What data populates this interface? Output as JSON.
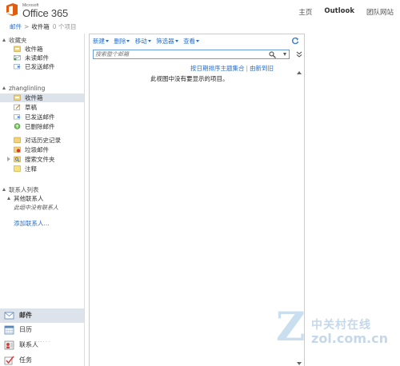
{
  "header": {
    "logo_small": "Microsoft",
    "logo_text": "Office 365",
    "nav": [
      {
        "label": "主页",
        "active": false
      },
      {
        "label": "Outlook",
        "active": true
      },
      {
        "label": "团队网站",
        "active": false
      }
    ]
  },
  "breadcrumb": {
    "root": "邮件",
    "separator": ">",
    "current": "收件箱",
    "count": "0 个项目"
  },
  "favorites": {
    "title": "收藏夹",
    "items": [
      {
        "label": "收件箱",
        "icon": "inbox-icon"
      },
      {
        "label": "未读邮件",
        "icon": "unread-mail-icon"
      },
      {
        "label": "已发送邮件",
        "icon": "sent-mail-icon"
      }
    ]
  },
  "mailbox": {
    "title": "zhanglinling",
    "items": [
      {
        "label": "收件箱",
        "icon": "inbox-icon",
        "selected": true
      },
      {
        "label": "草稿",
        "icon": "drafts-icon"
      },
      {
        "label": "已发送邮件",
        "icon": "sent-mail-icon"
      },
      {
        "label": "已删除邮件",
        "icon": "deleted-mail-icon"
      },
      {
        "label": "对话历史记录",
        "icon": "conversation-history-icon"
      },
      {
        "label": "垃圾邮件",
        "icon": "junk-mail-icon"
      },
      {
        "label": "搜索文件夹",
        "icon": "search-folder-icon"
      },
      {
        "label": "注释",
        "icon": "notes-icon"
      }
    ]
  },
  "contacts": {
    "title": "联系人列表",
    "group": "其他联系人",
    "empty": "此组中没有联系人",
    "add": "添加联系人..."
  },
  "bottom_nav": [
    {
      "label": "邮件",
      "icon": "mail-icon",
      "selected": true
    },
    {
      "label": "日历",
      "icon": "calendar-icon"
    },
    {
      "label": "联系人",
      "icon": "contacts-icon"
    },
    {
      "label": "任务",
      "icon": "tasks-icon"
    }
  ],
  "grip": "......",
  "toolbar": {
    "items": [
      "新建",
      "删除",
      "移动",
      "筛选器",
      "查看"
    ]
  },
  "search": {
    "placeholder": "搜索整个邮箱"
  },
  "sortbar": {
    "sort_label": "按日期排序主题集合",
    "group_label": "由新到旧"
  },
  "main": {
    "empty_message": "此视图中没有要显示的项目。"
  },
  "watermark": {
    "cn": "中关村在线",
    "url": "zol.com.cn"
  },
  "colors": {
    "link": "#2a6fc9",
    "selected_bg": "#dde3ea",
    "logo_orange": "#e35b0c"
  }
}
